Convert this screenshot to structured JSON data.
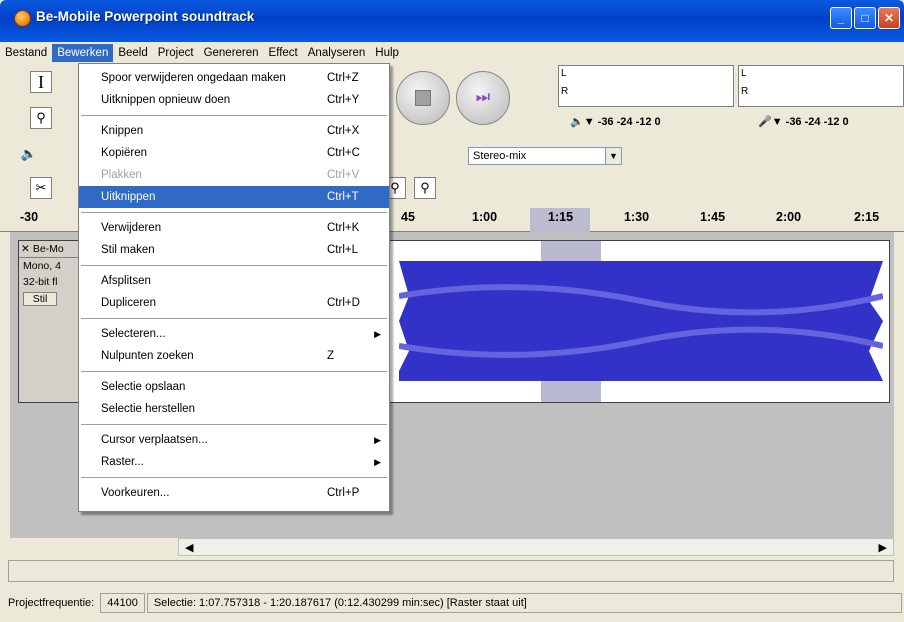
{
  "window": {
    "title": "Be-Mobile Powerpoint soundtrack"
  },
  "menubar": [
    "Bestand",
    "Bewerken",
    "Beeld",
    "Project",
    "Genereren",
    "Effect",
    "Analyseren",
    "Hulp"
  ],
  "meters": {
    "left_label": "L",
    "right_label": "R",
    "ticks": "-36  -24  -12  0"
  },
  "input_select": "Stereo-mix",
  "ruler": [
    "-30",
    "45",
    "1:00",
    "1:15",
    "1:30",
    "1:45",
    "2:00",
    "2:15"
  ],
  "track": {
    "name": "Be-Mo",
    "info1": "Mono, 4",
    "info2": "32-bit fl",
    "button": "Stil"
  },
  "dropdown": {
    "items": [
      {
        "label": "Spoor verwijderen ongedaan maken",
        "accel": "Ctrl+Z"
      },
      {
        "label": "Uitknippen opnieuw doen",
        "accel": "Ctrl+Y"
      },
      {
        "sep": true
      },
      {
        "label": "Knippen",
        "accel": "Ctrl+X"
      },
      {
        "label": "Kopiëren",
        "accel": "Ctrl+C"
      },
      {
        "label": "Plakken",
        "accel": "Ctrl+V",
        "disabled": true
      },
      {
        "label": "Uitknippen",
        "accel": "Ctrl+T",
        "highlighted": true
      },
      {
        "sep": true
      },
      {
        "label": "Verwijderen",
        "accel": "Ctrl+K"
      },
      {
        "label": "Stil maken",
        "accel": "Ctrl+L"
      },
      {
        "sep": true
      },
      {
        "label": "Afsplitsen",
        "accel": ""
      },
      {
        "label": "Dupliceren",
        "accel": "Ctrl+D"
      },
      {
        "sep": true
      },
      {
        "label": "Selecteren...",
        "accel": "",
        "submenu": true
      },
      {
        "label": "Nulpunten zoeken",
        "accel": "Z"
      },
      {
        "sep": true
      },
      {
        "label": "Selectie opslaan",
        "accel": ""
      },
      {
        "label": "Selectie herstellen",
        "accel": ""
      },
      {
        "sep": true
      },
      {
        "label": "Cursor verplaatsen...",
        "accel": "",
        "submenu": true
      },
      {
        "label": "Raster...",
        "accel": "",
        "submenu": true
      },
      {
        "sep": true
      },
      {
        "label": "Voorkeuren...",
        "accel": "Ctrl+P"
      }
    ]
  },
  "status": {
    "rate_label": "Projectfrequentie:",
    "rate_value": "44100",
    "selection": "Selectie: 1:07.757318 - 1:20.187617 (0:12.430299 min:sec)  [Raster staat uit]"
  },
  "colors": {
    "title_blue": "#0a5ae0",
    "highlight": "#316ac5",
    "wave": "#3232c8"
  }
}
